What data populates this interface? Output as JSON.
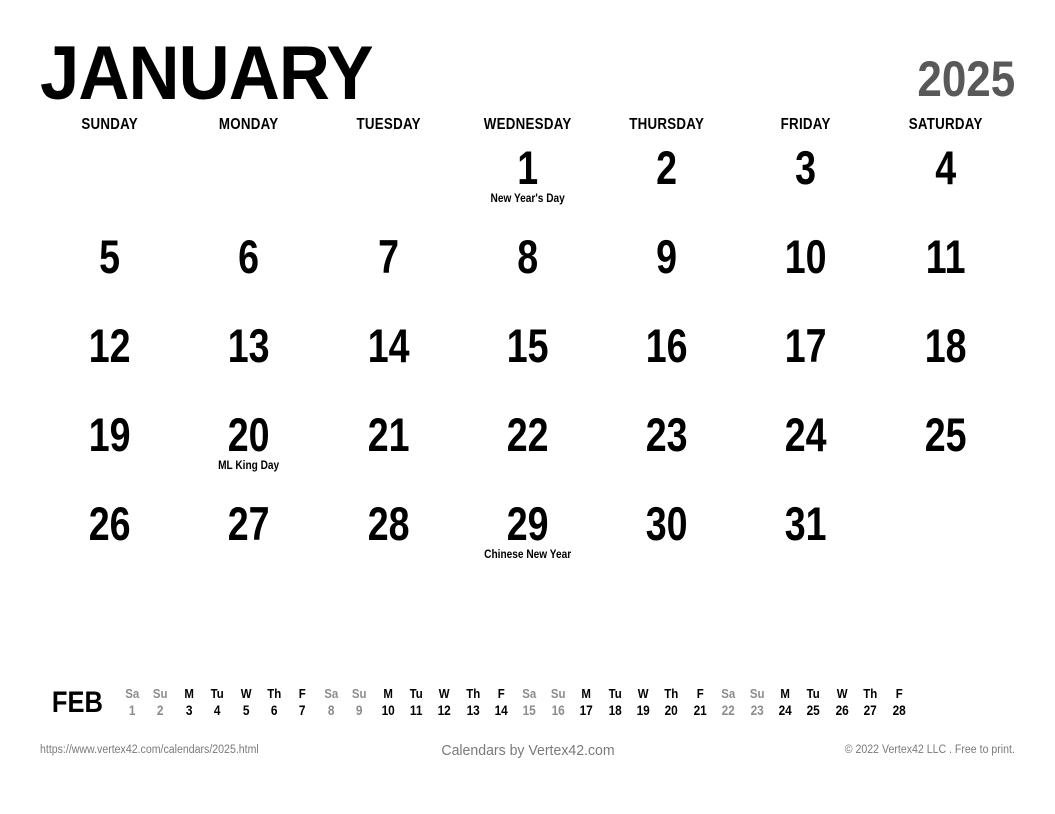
{
  "header": {
    "month": "JANUARY",
    "year": "2025"
  },
  "weekdays": [
    "SUNDAY",
    "MONDAY",
    "TUESDAY",
    "WEDNESDAY",
    "THURSDAY",
    "FRIDAY",
    "SATURDAY"
  ],
  "weeks": [
    [
      {
        "day": "",
        "event": ""
      },
      {
        "day": "",
        "event": ""
      },
      {
        "day": "",
        "event": ""
      },
      {
        "day": "1",
        "event": "New Year's Day"
      },
      {
        "day": "2",
        "event": ""
      },
      {
        "day": "3",
        "event": ""
      },
      {
        "day": "4",
        "event": ""
      }
    ],
    [
      {
        "day": "5",
        "event": ""
      },
      {
        "day": "6",
        "event": ""
      },
      {
        "day": "7",
        "event": ""
      },
      {
        "day": "8",
        "event": ""
      },
      {
        "day": "9",
        "event": ""
      },
      {
        "day": "10",
        "event": ""
      },
      {
        "day": "11",
        "event": ""
      }
    ],
    [
      {
        "day": "12",
        "event": ""
      },
      {
        "day": "13",
        "event": ""
      },
      {
        "day": "14",
        "event": ""
      },
      {
        "day": "15",
        "event": ""
      },
      {
        "day": "16",
        "event": ""
      },
      {
        "day": "17",
        "event": ""
      },
      {
        "day": "18",
        "event": ""
      }
    ],
    [
      {
        "day": "19",
        "event": ""
      },
      {
        "day": "20",
        "event": "ML King Day"
      },
      {
        "day": "21",
        "event": ""
      },
      {
        "day": "22",
        "event": ""
      },
      {
        "day": "23",
        "event": ""
      },
      {
        "day": "24",
        "event": ""
      },
      {
        "day": "25",
        "event": ""
      }
    ],
    [
      {
        "day": "26",
        "event": ""
      },
      {
        "day": "27",
        "event": ""
      },
      {
        "day": "28",
        "event": ""
      },
      {
        "day": "29",
        "event": "Chinese New Year"
      },
      {
        "day": "30",
        "event": ""
      },
      {
        "day": "31",
        "event": ""
      },
      {
        "day": "",
        "event": ""
      }
    ]
  ],
  "next_month": {
    "label": "FEB",
    "days": [
      {
        "dow": "Sa",
        "num": "1",
        "weekend": true
      },
      {
        "dow": "Su",
        "num": "2",
        "weekend": true
      },
      {
        "dow": "M",
        "num": "3",
        "weekend": false
      },
      {
        "dow": "Tu",
        "num": "4",
        "weekend": false
      },
      {
        "dow": "W",
        "num": "5",
        "weekend": false
      },
      {
        "dow": "Th",
        "num": "6",
        "weekend": false
      },
      {
        "dow": "F",
        "num": "7",
        "weekend": false
      },
      {
        "dow": "Sa",
        "num": "8",
        "weekend": true
      },
      {
        "dow": "Su",
        "num": "9",
        "weekend": true
      },
      {
        "dow": "M",
        "num": "10",
        "weekend": false
      },
      {
        "dow": "Tu",
        "num": "11",
        "weekend": false
      },
      {
        "dow": "W",
        "num": "12",
        "weekend": false
      },
      {
        "dow": "Th",
        "num": "13",
        "weekend": false
      },
      {
        "dow": "F",
        "num": "14",
        "weekend": false
      },
      {
        "dow": "Sa",
        "num": "15",
        "weekend": true
      },
      {
        "dow": "Su",
        "num": "16",
        "weekend": true
      },
      {
        "dow": "M",
        "num": "17",
        "weekend": false
      },
      {
        "dow": "Tu",
        "num": "18",
        "weekend": false
      },
      {
        "dow": "W",
        "num": "19",
        "weekend": false
      },
      {
        "dow": "Th",
        "num": "20",
        "weekend": false
      },
      {
        "dow": "F",
        "num": "21",
        "weekend": false
      },
      {
        "dow": "Sa",
        "num": "22",
        "weekend": true
      },
      {
        "dow": "Su",
        "num": "23",
        "weekend": true
      },
      {
        "dow": "M",
        "num": "24",
        "weekend": false
      },
      {
        "dow": "Tu",
        "num": "25",
        "weekend": false
      },
      {
        "dow": "W",
        "num": "26",
        "weekend": false
      },
      {
        "dow": "Th",
        "num": "27",
        "weekend": false
      },
      {
        "dow": "F",
        "num": "28",
        "weekend": false
      }
    ]
  },
  "footer": {
    "url": "https://www.vertex42.com/calendars/2025.html",
    "center": "Calendars by Vertex42.com",
    "copyright": "© 2022 Vertex42 LLC . Free to print."
  },
  "colors": {
    "text": "#000000",
    "year": "#595959",
    "muted": "#8c8c8c",
    "footer": "#7a7a7a",
    "background": "#ffffff"
  }
}
